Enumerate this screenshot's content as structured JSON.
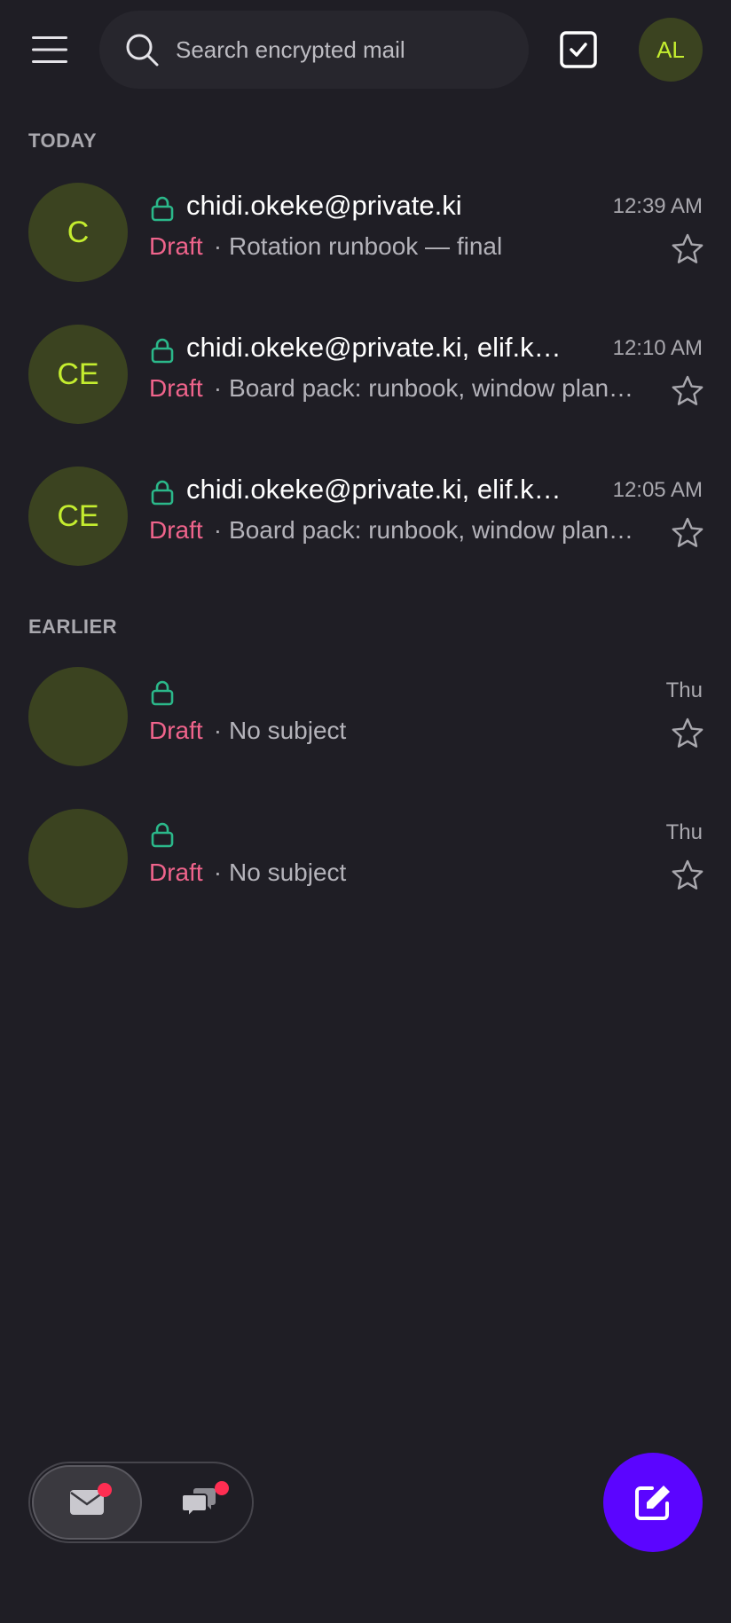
{
  "search": {
    "placeholder": "Search encrypted mail"
  },
  "user": {
    "initials": "AL"
  },
  "sections": {
    "today": "TODAY",
    "earlier": "EARLIER"
  },
  "messages": [
    {
      "initials": "C",
      "sender": "chidi.okeke@private.ki",
      "time": "12:39 AM",
      "status": "Draft",
      "subject": "Rotation runbook — final"
    },
    {
      "initials": "CE",
      "sender": "chidi.okeke@private.ki, elif.k…",
      "time": "12:10 AM",
      "status": "Draft",
      "subject": "Board pack: runbook, window plan…"
    },
    {
      "initials": "CE",
      "sender": "chidi.okeke@private.ki, elif.k…",
      "time": "12:05 AM",
      "status": "Draft",
      "subject": "Board pack: runbook, window plan…"
    },
    {
      "initials": "",
      "sender": "",
      "time": "Thu",
      "status": "Draft",
      "subject": "No subject"
    },
    {
      "initials": "",
      "sender": "",
      "time": "Thu",
      "status": "Draft",
      "subject": "No subject"
    }
  ],
  "separator": "·",
  "colors": {
    "background": "#1f1e25",
    "accent": "#5b05ff",
    "avatar_bg": "#3b4320",
    "avatar_text": "#c4ed2f",
    "draft": "#f0648c",
    "lock": "#2bb88a",
    "notification_dot": "#ff2e52"
  }
}
